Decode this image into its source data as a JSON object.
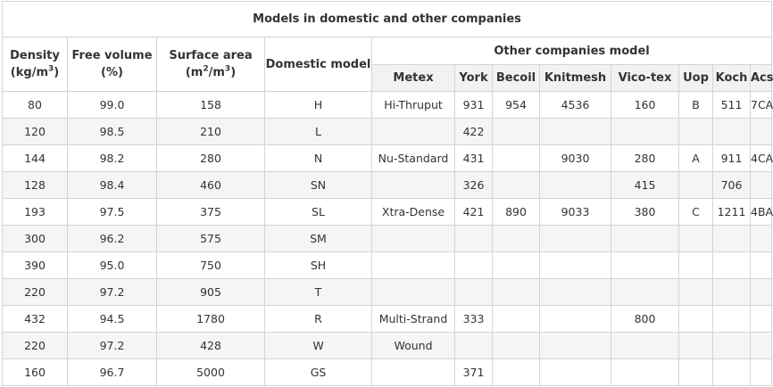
{
  "table": {
    "caption": "Models in domestic and other companies",
    "headers": {
      "density": "Density",
      "density_unit_pre": "(kg/m",
      "density_unit_sup": "3",
      "density_unit_post": ")",
      "free_volume": "Free volume",
      "free_volume_unit": "(%)",
      "surface_area": "Surface area",
      "surface_area_unit_pre": "(m",
      "surface_area_unit_sup1": "2",
      "surface_area_unit_mid": "/m",
      "surface_area_unit_sup2": "3",
      "surface_area_unit_post": ")",
      "domestic_model": "Domestic model",
      "other_companies": "Other companies model",
      "companies": [
        "Metex",
        "York",
        "Becoil",
        "Knitmesh",
        "Vico-tex",
        "Uop",
        "Koch",
        "Acs"
      ]
    },
    "rows": [
      [
        "80",
        "99.0",
        "158",
        "H",
        "Hi-Thruput",
        "931",
        "954",
        "4536",
        "160",
        "B",
        "511",
        "7CA"
      ],
      [
        "120",
        "98.5",
        "210",
        "L",
        "",
        "422",
        "",
        "",
        "",
        "",
        "",
        ""
      ],
      [
        "144",
        "98.2",
        "280",
        "N",
        "Nu-Standard",
        "431",
        "",
        "9030",
        "280",
        "A",
        "911",
        "4CA"
      ],
      [
        "128",
        "98.4",
        "460",
        "SN",
        "",
        "326",
        "",
        "",
        "415",
        "",
        "706",
        ""
      ],
      [
        "193",
        "97.5",
        "375",
        "SL",
        "Xtra-Dense",
        "421",
        "890",
        "9033",
        "380",
        "C",
        "1211",
        "4BA"
      ],
      [
        "300",
        "96.2",
        "575",
        "SM",
        "",
        "",
        "",
        "",
        "",
        "",
        "",
        ""
      ],
      [
        "390",
        "95.0",
        "750",
        "SH",
        "",
        "",
        "",
        "",
        "",
        "",
        "",
        ""
      ],
      [
        "220",
        "97.2",
        "905",
        "T",
        "",
        "",
        "",
        "",
        "",
        "",
        "",
        ""
      ],
      [
        "432",
        "94.5",
        "1780",
        "R",
        "Multi-Strand",
        "333",
        "",
        "",
        "800",
        "",
        "",
        ""
      ],
      [
        "220",
        "97.2",
        "428",
        "W",
        "Wound",
        "",
        "",
        "",
        "",
        "",
        "",
        ""
      ],
      [
        "160",
        "96.7",
        "5000",
        "GS",
        "",
        "371",
        "",
        "",
        "",
        "",
        "",
        ""
      ]
    ]
  }
}
